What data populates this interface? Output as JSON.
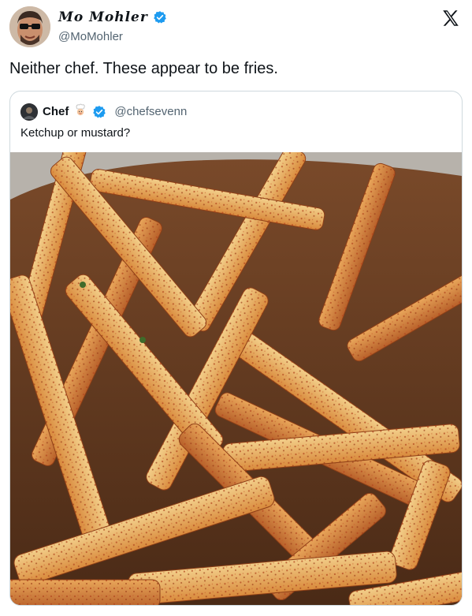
{
  "tweet": {
    "display_name": "Mo Mohler",
    "handle": "@MoMohler",
    "text": "Neither chef. These appear to be fries."
  },
  "quote": {
    "display_name": "Chef",
    "handle": "@chefsevenn",
    "text": "Ketchup or mustard?"
  },
  "icons": {
    "verified": "verified-badge-icon",
    "logo": "x-logo-icon",
    "chef_emoji": "chef-emoji-icon"
  },
  "colors": {
    "verified": "#1d9bf0",
    "secondary_text": "#536471",
    "border": "#cfd9de"
  }
}
